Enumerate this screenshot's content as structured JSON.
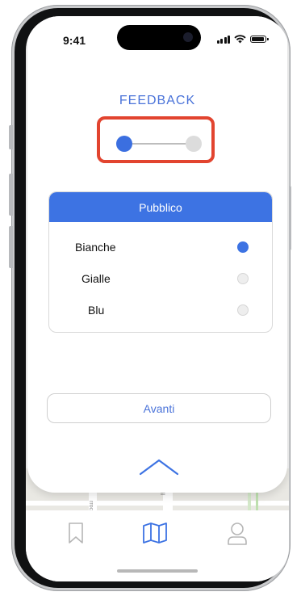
{
  "status_bar": {
    "time": "9:41"
  },
  "feedback": {
    "title": "FEEDBACK",
    "steps": [
      {
        "state": "active"
      },
      {
        "state": "inactive"
      }
    ],
    "panel": {
      "header": "Pubblico",
      "options": [
        {
          "label": "Bianche",
          "selected": true
        },
        {
          "label": "Gialle",
          "selected": false
        },
        {
          "label": "Blu",
          "selected": false
        }
      ]
    },
    "next_label": "Avanti"
  },
  "map": {
    "street_label_1": "rroco",
    "street_label_2": "ll"
  },
  "tabbar": {
    "items": [
      {
        "icon": "bookmark-icon",
        "active": false
      },
      {
        "icon": "map-icon",
        "active": true
      },
      {
        "icon": "profile-icon",
        "active": false
      }
    ]
  },
  "colors": {
    "accent": "#3d73e3",
    "title": "#4a73d9",
    "highlight_box": "#e2442f",
    "inactive": "#dcdcdc"
  }
}
